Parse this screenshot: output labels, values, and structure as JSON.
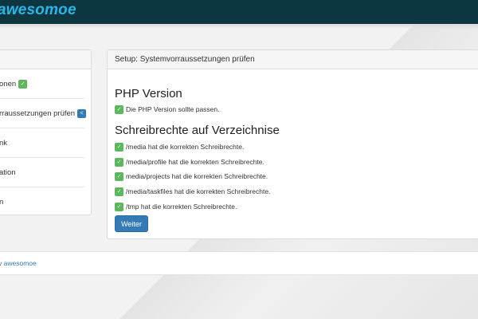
{
  "app": {
    "brand": "awesomoe"
  },
  "sidebar": {
    "items": [
      {
        "label": "onen",
        "status": "✓"
      },
      {
        "label": "rraussetzungen prüfen",
        "status": "<"
      },
      {
        "label": "nk"
      },
      {
        "label": "ation"
      },
      {
        "label": "n"
      }
    ]
  },
  "setup": {
    "title": "Setup: Systemvorraussetzungen prüfen",
    "php_heading": "PHP Version",
    "php_checks": [
      {
        "text": "Die PHP Version sollte passen.",
        "status": "✓"
      }
    ],
    "write_heading": "Schreibrechte auf Verzeichnise",
    "write_checks": [
      {
        "text": "/media hat die korrekten Schreibrechte.",
        "status": "✓"
      },
      {
        "text": "/media/profile hat die korrekten Schreibrechte.",
        "status": "✓"
      },
      {
        "text": "media/projects hat die korrekten Schreibrechte.",
        "status": "✓"
      },
      {
        "text": "/media/taskfiles hat die korrekten Schreibrechte.",
        "status": "✓"
      },
      {
        "text": "/tmp hat die korrekten Schreibrechte.",
        "status": "✓"
      }
    ],
    "next_button": "Weiter"
  },
  "footer": {
    "prefix": "y",
    "link": "awesomoe"
  },
  "colors": {
    "topbar": "#0c3640",
    "brand": "#2bb6e8",
    "success": "#5cb85c",
    "primary": "#337ab7"
  }
}
